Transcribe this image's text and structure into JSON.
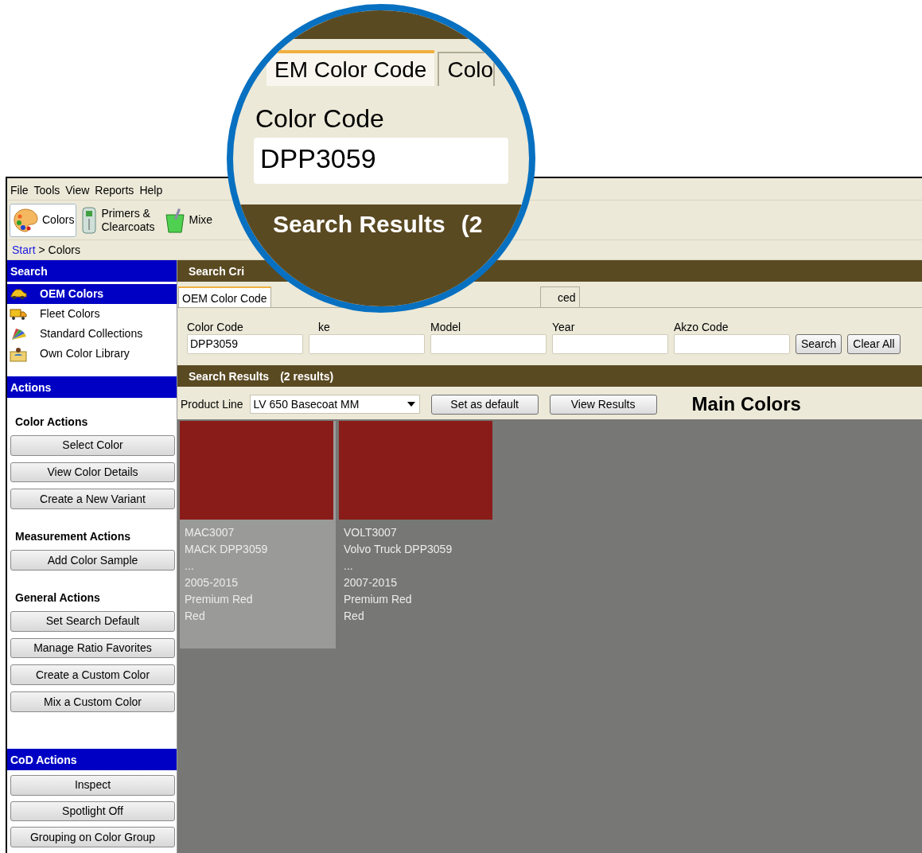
{
  "menu": [
    "File",
    "Tools",
    "View",
    "Reports",
    "Help"
  ],
  "toolbar": [
    {
      "label": "Colors",
      "kind": "palette",
      "selected": true
    },
    {
      "label": "Primers & Clearcoats",
      "kind": "bottle",
      "selected": false
    },
    {
      "label": "Mixe",
      "kind": "cup",
      "selected": false
    }
  ],
  "breadcrumb": {
    "link": "Start",
    "separator": ">",
    "current": "Colors"
  },
  "sidebar": {
    "search_header": "Search",
    "search_items": [
      {
        "label": "OEM Colors",
        "kind": "car",
        "selected": true
      },
      {
        "label": "Fleet Colors",
        "kind": "truck",
        "selected": false
      },
      {
        "label": "Standard Collections",
        "kind": "fan",
        "selected": false
      },
      {
        "label": "Own Color Library",
        "kind": "folder",
        "selected": false
      }
    ],
    "actions_header": "Actions",
    "action_groups": [
      {
        "title": "Color Actions",
        "buttons": [
          "Select Color",
          "View Color Details",
          "Create a New Variant"
        ]
      },
      {
        "title": "Measurement Actions",
        "buttons": [
          "Add Color Sample"
        ]
      },
      {
        "title": "General Actions",
        "buttons": [
          "Set Search Default",
          "Manage Ratio Favorites",
          "Create a Custom Color",
          "Mix a Custom Color"
        ]
      }
    ],
    "cod_header": "CoD Actions",
    "cod_buttons": [
      "Inspect",
      "Spotlight Off",
      "Grouping on Color Group"
    ]
  },
  "search_criteria": {
    "title": "Search Cri",
    "tabs": [
      {
        "label": "OEM Color Code",
        "selected": true
      },
      {
        "label": "ced",
        "selected": false
      }
    ],
    "fields": [
      {
        "label": "Color Code",
        "value": "DPP3059"
      },
      {
        "label": "ke"
      },
      {
        "label": "Model"
      },
      {
        "label": "Year"
      },
      {
        "label": "Akzo Code"
      }
    ],
    "buttons": [
      "Search",
      "Clear All"
    ]
  },
  "search_results": {
    "title": "Search Results",
    "count": "(2 results)",
    "product_line_label": "Product Line",
    "product_line": "LV 650 Basecoat MM",
    "buttons": [
      "Set as default",
      "View Results"
    ],
    "heading": "Main Colors",
    "swatches": [
      {
        "color": "#891c19",
        "selected": true,
        "lines": [
          "MAC3007",
          "MACK DPP3059",
          "...",
          "2005-2015",
          "Premium Red",
          "Red"
        ]
      },
      {
        "color": "#891c19",
        "selected": false,
        "lines": [
          "VOLT3007",
          "Volvo Truck DPP3059",
          "...",
          "2007-2015",
          "Premium Red",
          "Red"
        ]
      }
    ]
  },
  "magnifier": {
    "tabs": [
      {
        "label": "EM Color Code",
        "selected": true
      },
      {
        "label": "Colo",
        "selected": false
      }
    ],
    "field_label": "Color Code",
    "field_value": "DPP3059",
    "results_title": "Search Results",
    "results_count": "(2"
  }
}
